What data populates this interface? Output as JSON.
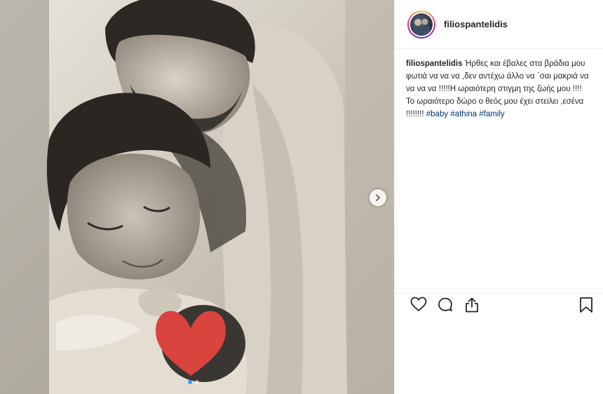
{
  "post": {
    "username": "filiospantelidis",
    "caption_user": "filiospantelidis",
    "caption_text": " Ήρθες και έβαλες στα βράδια μου φωτιά να να να ,δεν αντέχω άλλο να ΄σαι μακριά να να να να !!!!!Η ωραιότερη στιγμη της ζωής μου !!!! Το ωραιότερο δώρο ο θεός μου έχει στειλει ,εσένα !!!!!!!! ",
    "hashtags": [
      "#baby",
      "#athina",
      "#family"
    ]
  },
  "media": {
    "carousel_count": 2,
    "carousel_active_index": 0
  },
  "icons": {
    "next": "chevron-right-icon",
    "like": "heart-outline-icon",
    "comment": "comment-bubble-icon",
    "share": "share-icon",
    "save": "bookmark-icon"
  },
  "colors": {
    "hashtag": "#003569",
    "text": "#262626",
    "divider": "#efefef",
    "heart_sticker": "#d9443f",
    "active_dot": "#3897f0"
  }
}
